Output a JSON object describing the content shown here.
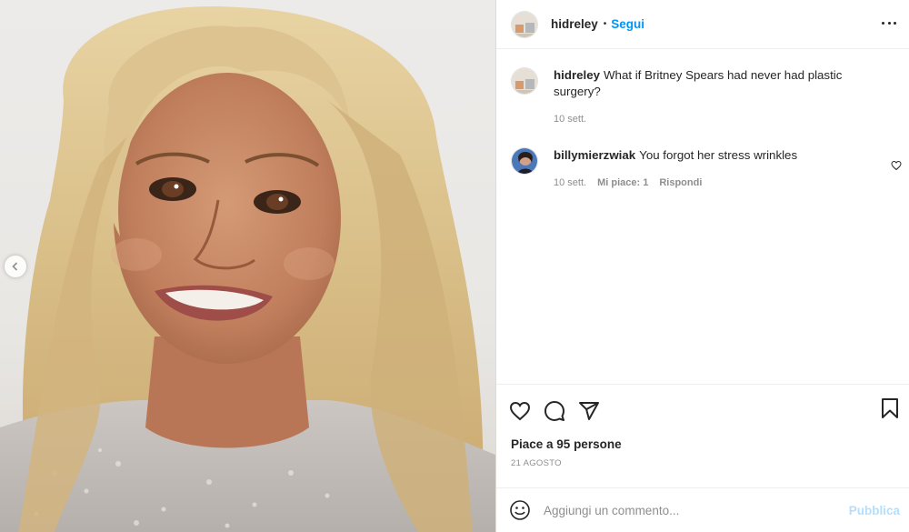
{
  "post": {
    "author": "hidreley",
    "follow_label": "Segui",
    "separator": "•",
    "image_alt_description": ""
  },
  "comments": [
    {
      "user": "hidreley",
      "text": "What if Britney Spears had never had plastic surgery?",
      "time": "10 sett."
    },
    {
      "user": "billymierzwiak",
      "text": "You forgot her stress wrinkles",
      "time": "10 sett.",
      "likes": "Mi piace: 1",
      "reply_label": "Rispondi"
    }
  ],
  "likes": {
    "prefix": "Piace a ",
    "count": "95 persone"
  },
  "date": "21 AGOSTO",
  "add_comment": {
    "placeholder": "Aggiungi un commento...",
    "publish_label": "Pubblica"
  },
  "colors": {
    "accent": "#0095f6",
    "publish_disabled": "#b2dffc",
    "muted": "#8e8e8e",
    "text": "#262626",
    "border": "#efefef"
  },
  "icons": {
    "options": "more-horizontal-icon",
    "like": "heart-icon",
    "comment": "speech-bubble-icon",
    "share": "paper-plane-icon",
    "save": "bookmark-icon",
    "emoji": "smiley-icon",
    "carousel_prev": "chevron-left-icon"
  }
}
